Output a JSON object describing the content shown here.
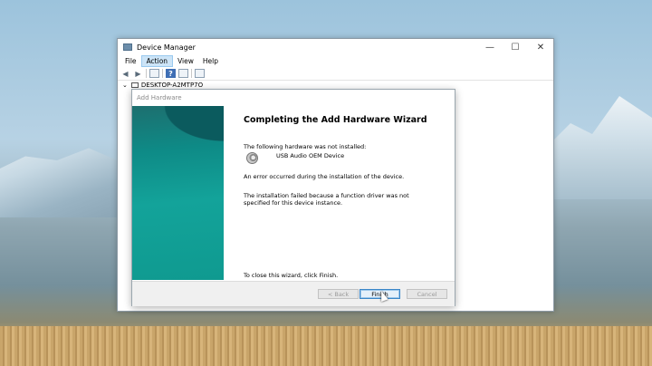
{
  "device_manager": {
    "title": "Device Manager",
    "controls": {
      "minimize": "—",
      "maximize": "☐",
      "close": "✕"
    },
    "menu": [
      "File",
      "Action",
      "View",
      "Help"
    ],
    "active_menu": "Action",
    "tree_root": "DESKTOP-A2MTP7O"
  },
  "wizard": {
    "title": "Add Hardware",
    "heading": "Completing the Add Hardware Wizard",
    "intro": "The following hardware was not installed:",
    "device_name": "USB Audio OEM Device",
    "error": "An error occurred during the installation of the device.",
    "failure_line1": "The installation failed because a function driver was not",
    "failure_line2": "specified for this device instance.",
    "close_hint": "To close this wizard, click Finish.",
    "buttons": {
      "back": "< Back",
      "finish": "Finish",
      "cancel": "Cancel"
    }
  },
  "colors": {
    "wizard_side": "#13a39a",
    "menu_active": "#cce4f7"
  }
}
